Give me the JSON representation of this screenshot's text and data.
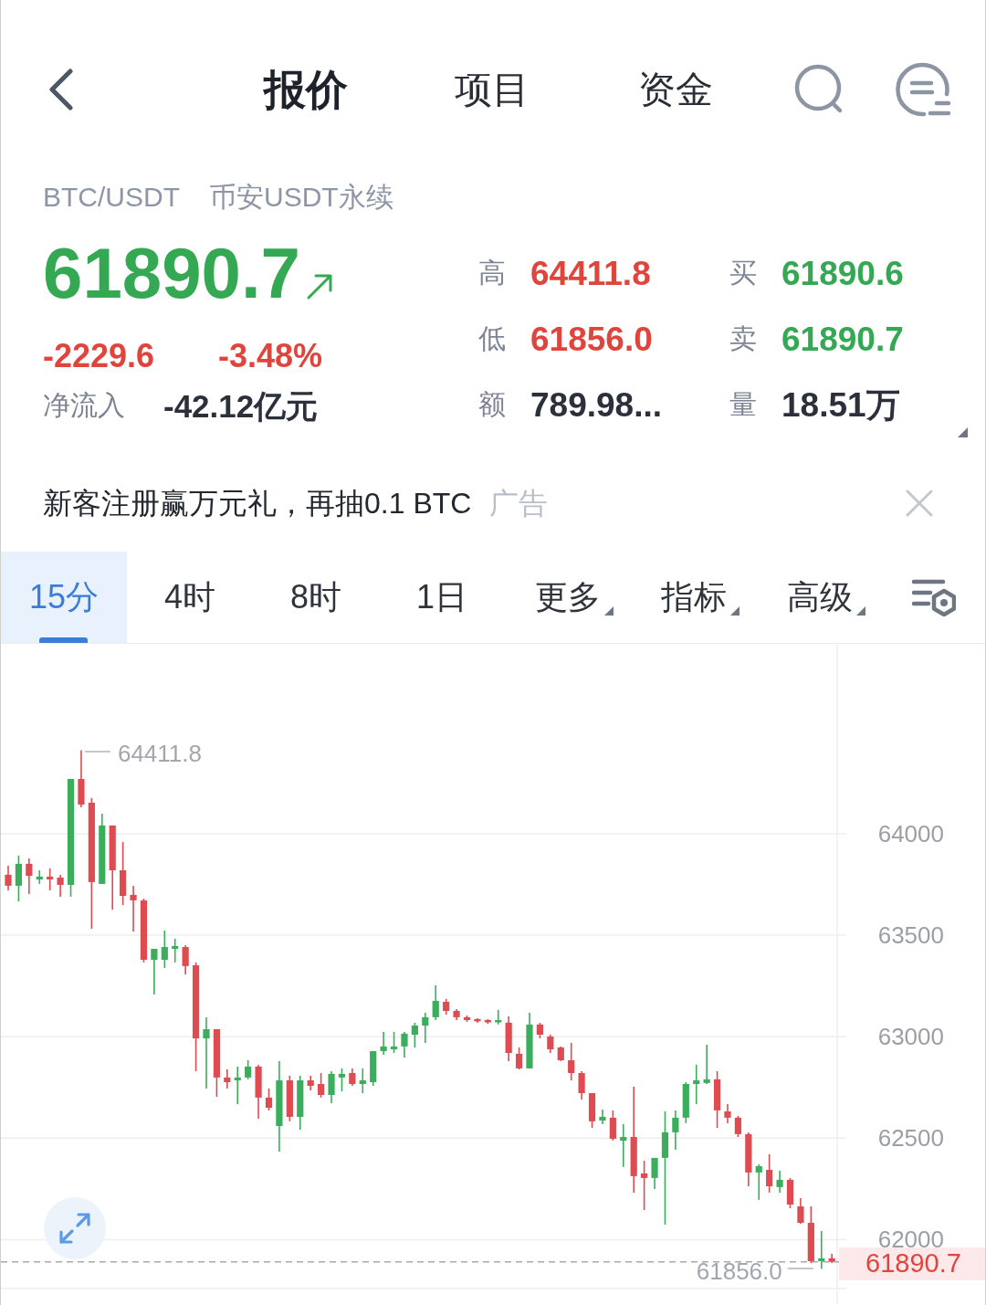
{
  "header": {
    "tabs": [
      {
        "label": "报价",
        "selected": true
      },
      {
        "label": "项目",
        "selected": false
      },
      {
        "label": "资金",
        "selected": false
      }
    ]
  },
  "instrument": {
    "symbol": "BTC/USDT",
    "market": "币安USDT永续"
  },
  "quote": {
    "last_price": "61890.7",
    "rising": true,
    "change": "-2229.6",
    "change_percent": "-3.48%",
    "change_rising": false,
    "net_inflow_label": "净流入",
    "net_inflow": "-42.12亿元"
  },
  "stats": [
    {
      "label": "高",
      "value": "64411.8",
      "color": "#e0453d"
    },
    {
      "label": "买",
      "value": "61890.6",
      "color": "#34a853"
    },
    {
      "label": "低",
      "value": "61856.0",
      "color": "#e0453d"
    },
    {
      "label": "卖",
      "value": "61890.7",
      "color": "#34a853"
    },
    {
      "label": "额",
      "value": "789.98...",
      "color": "#2b303b"
    },
    {
      "label": "量",
      "value": "18.51万",
      "color": "#2b303b"
    }
  ],
  "ad": {
    "text": "新客注册赢万元礼，再抽0.1 BTC",
    "tag": "广告"
  },
  "intervals": [
    {
      "label": "15分",
      "kind": "interval",
      "selected": true
    },
    {
      "label": "4时",
      "kind": "interval",
      "selected": false
    },
    {
      "label": "8时",
      "kind": "interval",
      "selected": false
    },
    {
      "label": "1日",
      "kind": "interval",
      "selected": false
    },
    {
      "label": "更多",
      "kind": "dropdown",
      "selected": false
    },
    {
      "label": "指标",
      "kind": "dropdown",
      "selected": false
    },
    {
      "label": "高级",
      "kind": "dropdown",
      "selected": false
    }
  ],
  "chart": {
    "high_label": "64411.8",
    "low_label": "61856.0",
    "chart_data": {
      "type": "candlestick",
      "ohlc": [
        [
          63798,
          63843,
          63721,
          63744
        ],
        [
          63744,
          63892,
          63667,
          63852
        ],
        [
          63852,
          63879,
          63703,
          63793
        ],
        [
          63775,
          63820,
          63753,
          63789
        ],
        [
          63789,
          63829,
          63721,
          63775
        ],
        [
          63784,
          63798,
          63690,
          63748
        ],
        [
          63748,
          64270,
          63690,
          64270
        ],
        [
          64270,
          64411.8,
          64131,
          64144
        ],
        [
          64153,
          64176,
          63532,
          63762
        ],
        [
          63753,
          64099,
          63753,
          64041
        ],
        [
          64041,
          64041,
          63627,
          63820
        ],
        [
          63820,
          63960,
          63649,
          63694
        ],
        [
          63699,
          63744,
          63519,
          63672
        ],
        [
          63672,
          63681,
          63366,
          63379
        ],
        [
          63379,
          63433,
          63208,
          63433
        ],
        [
          63379,
          63523,
          63339,
          63442
        ],
        [
          63433,
          63483,
          63366,
          63447
        ],
        [
          63442,
          63451,
          63307,
          63348
        ],
        [
          63352,
          63366,
          62830,
          62992
        ],
        [
          62992,
          63096,
          62745,
          63037
        ],
        [
          63037,
          63037,
          62704,
          62799
        ],
        [
          62799,
          62839,
          62745,
          62776
        ],
        [
          62785,
          62853,
          62668,
          62799
        ],
        [
          62799,
          62884,
          62790,
          62853
        ],
        [
          62853,
          62862,
          62596,
          62700
        ],
        [
          62700,
          62745,
          62637,
          62650
        ],
        [
          62560,
          62880,
          62434,
          62785
        ],
        [
          62785,
          62808,
          62583,
          62605
        ],
        [
          62605,
          62808,
          62542,
          62785
        ],
        [
          62785,
          62808,
          62736,
          62758
        ],
        [
          62767,
          62821,
          62700,
          62713
        ],
        [
          62713,
          62830,
          62673,
          62817
        ],
        [
          62799,
          62844,
          62731,
          62817
        ],
        [
          62821,
          62844,
          62758,
          62767
        ],
        [
          62767,
          62844,
          62722,
          62785
        ],
        [
          62776,
          62929,
          62758,
          62929
        ],
        [
          62929,
          63024,
          62911,
          62952
        ],
        [
          62938,
          63024,
          62920,
          62952
        ],
        [
          62952,
          63024,
          62898,
          63015
        ],
        [
          63010,
          63069,
          62947,
          63055
        ],
        [
          63055,
          63118,
          62970,
          63096
        ],
        [
          63096,
          63253,
          63082,
          63177
        ],
        [
          63172,
          63186,
          63109,
          63127
        ],
        [
          63127,
          63136,
          63082,
          63096
        ],
        [
          63096,
          63105,
          63073,
          63082
        ],
        [
          63087,
          63091,
          63069,
          63078
        ],
        [
          63082,
          63087,
          63064,
          63073
        ],
        [
          63073,
          63132,
          63060,
          63082
        ],
        [
          63069,
          63100,
          62880,
          62920
        ],
        [
          62916,
          62947,
          62839,
          62844
        ],
        [
          62844,
          63118,
          62844,
          63060
        ],
        [
          63060,
          63069,
          62992,
          63010
        ],
        [
          63001,
          63010,
          62920,
          62938
        ],
        [
          62947,
          62952,
          62880,
          62884
        ],
        [
          62884,
          62970,
          62785,
          62821
        ],
        [
          62821,
          62830,
          62691,
          62722
        ],
        [
          62722,
          62722,
          62551,
          62583
        ],
        [
          62587,
          62641,
          62569,
          62605
        ],
        [
          62601,
          62637,
          62488,
          62497
        ],
        [
          62488,
          62569,
          62358,
          62506
        ],
        [
          62506,
          62754,
          62232,
          62313
        ],
        [
          62326,
          62389,
          62146,
          62304
        ],
        [
          62304,
          62403,
          62250,
          62403
        ],
        [
          62403,
          62632,
          62074,
          62529
        ],
        [
          62529,
          62637,
          62443,
          62601
        ],
        [
          62601,
          62776,
          62574,
          62767
        ],
        [
          62767,
          62862,
          62668,
          62785
        ],
        [
          62772,
          62961,
          62767,
          62790
        ],
        [
          62790,
          62830,
          62551,
          62637
        ],
        [
          62632,
          62668,
          62574,
          62601
        ],
        [
          62601,
          62610,
          62506,
          62520
        ],
        [
          62520,
          62529,
          62263,
          62331
        ],
        [
          62331,
          62371,
          62196,
          62362
        ],
        [
          62344,
          62421,
          62232,
          62263
        ],
        [
          62259,
          62340,
          62232,
          62295
        ],
        [
          62295,
          62304,
          62155,
          62173
        ],
        [
          62164,
          62205,
          62079,
          62083
        ],
        [
          62083,
          62164,
          61885,
          61894
        ],
        [
          61894,
          62043,
          61856.0,
          61908
        ],
        [
          61908,
          61930,
          61885,
          61890.7
        ]
      ],
      "ylim": [
        61682.5,
        64936
      ],
      "yticks": [
        62000,
        62500,
        63000,
        63500,
        64000
      ],
      "grid": true,
      "ref_lines": [
        {
          "axis": "y",
          "value": 61890.7,
          "label": "61890.7"
        }
      ]
    }
  }
}
